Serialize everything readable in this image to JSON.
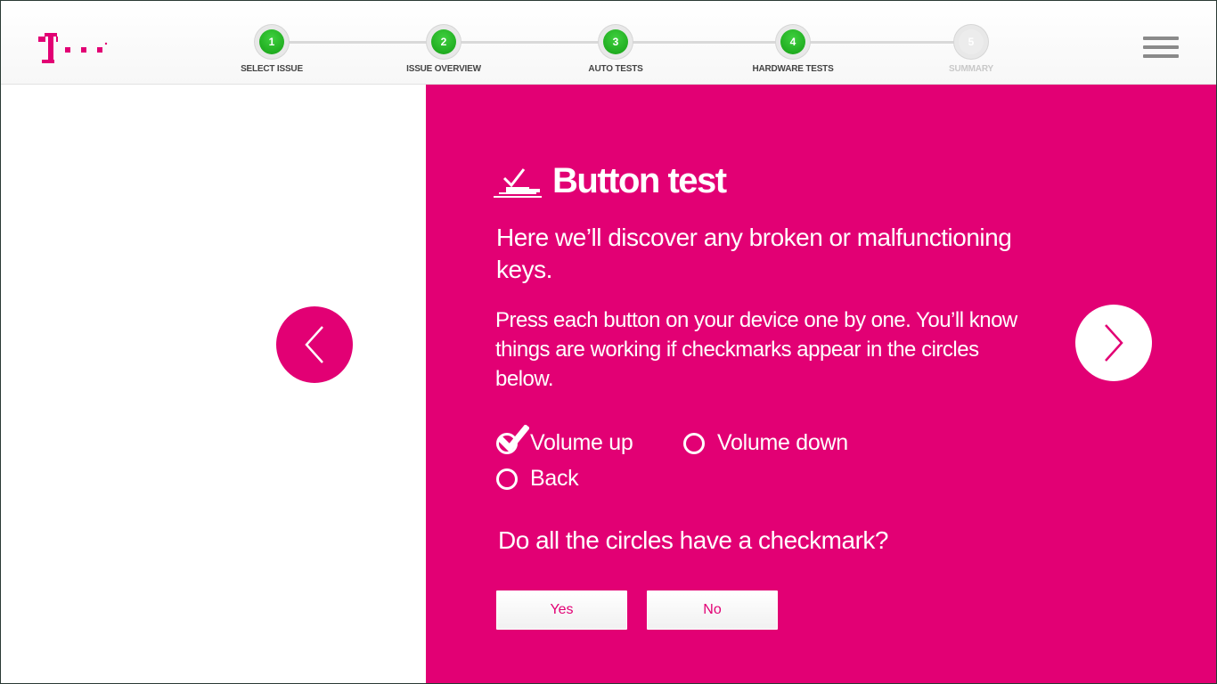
{
  "header": {
    "logo_icon": "t-mobile-logo",
    "steps": [
      {
        "number": "1",
        "label": "SELECT ISSUE",
        "state": "done"
      },
      {
        "number": "2",
        "label": "ISSUE OVERVIEW",
        "state": "done"
      },
      {
        "number": "3",
        "label": "AUTO TESTS",
        "state": "done"
      },
      {
        "number": "4",
        "label": "HARDWARE TESTS",
        "state": "done"
      },
      {
        "number": "5",
        "label": "SUMMARY",
        "state": "pending"
      }
    ],
    "menu_icon": "hamburger-menu-icon"
  },
  "colors": {
    "brand_magenta": "#e20074",
    "step_done_green": "#1ea81e",
    "white": "#ffffff"
  },
  "panel": {
    "title": "Button test",
    "title_icon": "button-press-icon",
    "subtitle": "Here we’ll discover any broken or malfunctioning keys.",
    "instructions": "Press each button on your device one by one. You’ll know things are working if checkmarks appear in the circles below.",
    "options": [
      {
        "label": "Volume up",
        "checked": true
      },
      {
        "label": "Volume down",
        "checked": false
      },
      {
        "label": "Back",
        "checked": false
      }
    ],
    "question": "Do all the circles have a checkmark?",
    "yes_label": "Yes",
    "no_label": "No"
  },
  "nav": {
    "prev_icon": "chevron-left-icon",
    "next_icon": "chevron-right-icon"
  }
}
